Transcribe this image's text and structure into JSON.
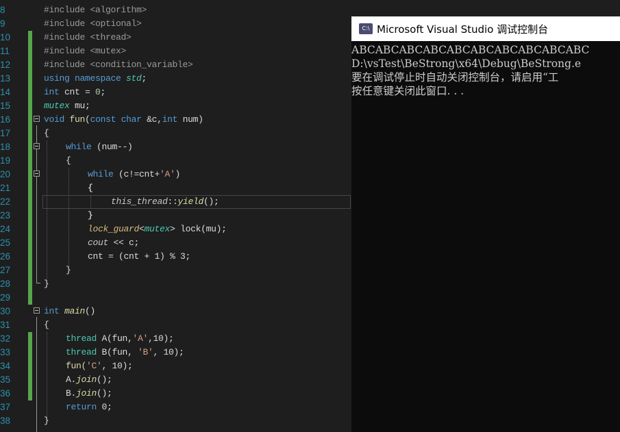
{
  "console": {
    "title": "Microsoft Visual Studio 调试控制台",
    "icon_label": "C:\\",
    "output": [
      "ABCABCABCABCABCABCABCABCABCABC",
      "D:\\vsTest\\BeStrong\\x64\\Debug\\BeStrong.e",
      "要在调试停止时自动关闭控制台，请启用“工",
      "按任意键关闭此窗口. . ."
    ]
  },
  "editor": {
    "line_numbers": [
      "8",
      "9",
      "10",
      "11",
      "12",
      "13",
      "14",
      "15",
      "16",
      "17",
      "18",
      "19",
      "20",
      "21",
      "22",
      "23",
      "24",
      "25",
      "26",
      "27",
      "28",
      "29",
      "30",
      "31",
      "32",
      "33",
      "34",
      "35",
      "36",
      "37",
      "38"
    ],
    "tokens": {
      "inc_algorithm": "#include <algorithm>",
      "inc_optional": "#include <optional>",
      "inc_thread": "#include <thread>",
      "inc_mutex": "#include <mutex>",
      "inc_condvar": "#include <condition_variable>",
      "using": "using namespace ",
      "std": "std",
      "semi": ";",
      "int": "int",
      "cnt_decl": " cnt = ",
      "zero": "0",
      "mutex": "mutex",
      "mu_decl": " mu;",
      "void": "void",
      "fun": "fun",
      "paren_open": "(",
      "const": "const",
      "char": "char",
      "c_ref": " &c,",
      "num_param": " num)",
      "brace_open": "{",
      "brace_close": "}",
      "while": "while",
      "while_cond_1": " (num--)",
      "while_cond_2a": " (c!=cnt+",
      "char_A": "'A'",
      "paren_close": ")",
      "this_thread": "this_thread",
      "scope": "::",
      "yield": "yield",
      "call_end": "();",
      "lock_guard": "lock_guard",
      "lt": "<",
      "gt": ">",
      "lock_rest": " lock(mu);",
      "cout": "cout",
      "cout_rest": " << c;",
      "cnt_update": "cnt = (cnt + 1) % 3;",
      "main": "main",
      "main_parens": "()",
      "thread": "thread",
      "thread_A_1": " A(fun,",
      "thread_A_2": ",10);",
      "thread_B_1": " B(fun, ",
      "char_B": "'B'",
      "thread_B_2": ", 10);",
      "fun_C_1": "fun(",
      "char_C": "'C'",
      "fun_C_2": ", 10);",
      "A_dot": "A.",
      "B_dot": "B.",
      "join": "join",
      "return": "return",
      "ret_val": " 0;"
    }
  },
  "colors": {
    "editor_bg": "#1e1e1e",
    "line_number": "#2b91af",
    "keyword": "#569cd6",
    "type": "#4ec9b0",
    "function": "#dcdcaa",
    "string": "#d69d85",
    "change_bar": "#57a64a",
    "console_bg": "#0c0c0c"
  }
}
